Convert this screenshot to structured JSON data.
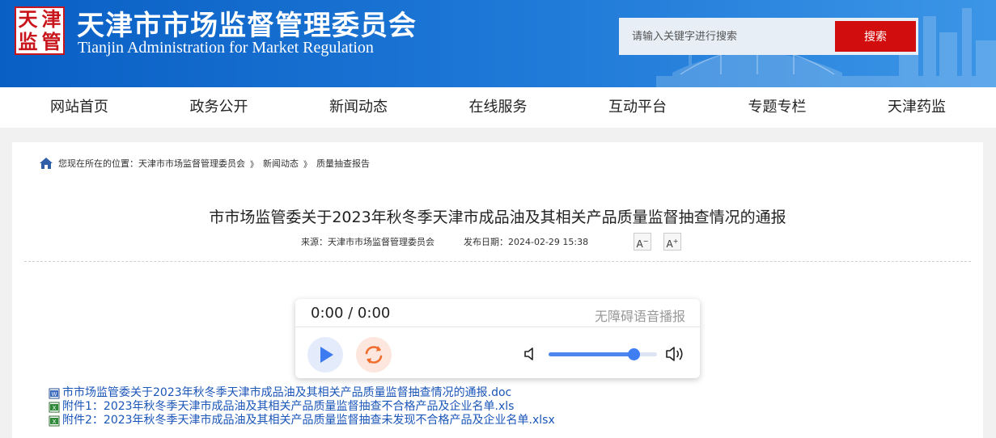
{
  "header": {
    "logo_chars": [
      "天",
      "津",
      "监",
      "管"
    ],
    "title": "天津市市场监督管理委员会",
    "subtitle": "Tianjin Administration for Market Regulation",
    "search_placeholder": "请输入关键字进行搜索",
    "search_button": "搜索"
  },
  "nav": {
    "items": [
      "网站首页",
      "政务公开",
      "新闻动态",
      "在线服务",
      "互动平台",
      "专题专栏",
      "天津药监"
    ]
  },
  "breadcrumb": {
    "prefix": "您现在所在的位置：",
    "items": [
      "天津市市场监督管理委员会",
      "新闻动态",
      "质量抽查报告"
    ],
    "separator": "》"
  },
  "article": {
    "title": "市市场监管委关于2023年秋冬季天津市成品油及其相关产品质量监督抽查情况的通报",
    "source": "来源：天津市市场监督管理委员会",
    "date": "发布日期：2024-02-29 15:38",
    "font_decrease": "A",
    "font_increase": "A"
  },
  "player": {
    "time": "0:00 / 0:00",
    "label": "无障碍语音播报",
    "volume": 0.78
  },
  "attachments": [
    {
      "type": "doc",
      "text": "市市场监管委关于2023年秋冬季天津市成品油及其相关产品质量监督抽查情况的通报.doc"
    },
    {
      "type": "xls",
      "text": "附件1：2023年秋冬季天津市成品油及其相关产品质量监督抽查不合格产品及企业名单.xls"
    },
    {
      "type": "xls",
      "text": "附件2：2023年秋冬季天津市成品油及其相关产品质量监督抽查未发现不合格产品及企业名单.xlsx"
    }
  ],
  "colors": {
    "header_blue": "#0a5fc4",
    "search_red": "#d20d0d",
    "link_blue": "#1a55b8",
    "logo_red": "#c8141b"
  }
}
